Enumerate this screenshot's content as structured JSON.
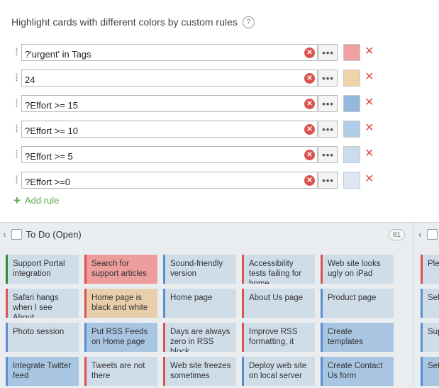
{
  "header": {
    "title": "Highlight cards with different colors by custom rules",
    "help_glyph": "?"
  },
  "rules": [
    {
      "expression": "?'urgent' in Tags",
      "color": "#f0a0a0"
    },
    {
      "expression": "24",
      "color": "#f0d3a9"
    },
    {
      "expression": "?Effort >= 15",
      "color": "#92b8dc"
    },
    {
      "expression": "?Effort >= 10",
      "color": "#b0cde8"
    },
    {
      "expression": "?Effort >= 5",
      "color": "#cadced"
    },
    {
      "expression": "?Effort >=0",
      "color": "#dde7f1"
    }
  ],
  "rule_clear_glyph": "✕",
  "rule_more_glyph": "•••",
  "rule_remove_glyph": "✕",
  "add_rule": {
    "plus": "+",
    "label": "Add rule"
  },
  "board": {
    "column": {
      "title": "To Do (Open)",
      "count": "81",
      "chevron": "‹"
    },
    "next_column_chevron": "‹",
    "cards": [
      {
        "text": "Support Portal integration",
        "bg": "#cfdde9",
        "stripe": "#2e8b3a"
      },
      {
        "text": "Search for support articles",
        "bg": "#ee9d9d",
        "stripe": "#d9534f"
      },
      {
        "text": "Sound-friendly version",
        "bg": "#cfdde9",
        "stripe": "#5a8ed0"
      },
      {
        "text": "Accessibility tests failing for home",
        "bg": "#cfdde9",
        "stripe": "#d9534f"
      },
      {
        "text": "Web site looks ugly on iPad",
        "bg": "#cfdde9",
        "stripe": "#d9534f"
      },
      {
        "text": "Safari hangs when I see About",
        "bg": "#cfdde9",
        "stripe": "#d9534f"
      },
      {
        "text": "Home page is black and white",
        "bg": "#e9ceab",
        "stripe": "#d9534f"
      },
      {
        "text": "Home page",
        "bg": "#cfdde9",
        "stripe": "#5a8ed0"
      },
      {
        "text": "About Us page",
        "bg": "#cfdde9",
        "stripe": "#d9534f"
      },
      {
        "text": "Product page",
        "bg": "#cfdde9",
        "stripe": "#5a8ed0"
      },
      {
        "text": "Photo session",
        "bg": "#cfdde9",
        "stripe": "#5a8ed0"
      },
      {
        "text": "Put RSS Feeds on Home page",
        "bg": "#a8c6e2",
        "stripe": "#5a8ed0"
      },
      {
        "text": "Days are always zero in RSS block",
        "bg": "#cfdde9",
        "stripe": "#d9534f"
      },
      {
        "text": "Improve RSS formatting, it",
        "bg": "#cfdde9",
        "stripe": "#d9534f"
      },
      {
        "text": "Create templates",
        "bg": "#a8c6e2",
        "stripe": "#5a8ed0"
      },
      {
        "text": "Integrate Twitter feed",
        "bg": "#a8c6e2",
        "stripe": "#5a8ed0"
      },
      {
        "text": "Tweets are not there",
        "bg": "#cfdde9",
        "stripe": "#d9534f"
      },
      {
        "text": "Web site freezes sometimes",
        "bg": "#cfdde9",
        "stripe": "#d9534f"
      },
      {
        "text": "Deploy web site on local server",
        "bg": "#cfdde9",
        "stripe": "#5a8ed0"
      },
      {
        "text": "Create Contact Us form",
        "bg": "#a8c6e2",
        "stripe": "#5a8ed0"
      }
    ],
    "partial_cards": [
      {
        "text": "Plea fee",
        "bg": "#cfdde9",
        "stripe": "#d9534f"
      },
      {
        "text": "Sele dev",
        "bg": "#cfdde9",
        "stripe": "#5a8ed0"
      },
      {
        "text": "Sup",
        "bg": "#cfdde9",
        "stripe": "#5a8ed0"
      },
      {
        "text": "Set",
        "bg": "#a8c6e2",
        "stripe": "#5a8ed0"
      }
    ]
  }
}
